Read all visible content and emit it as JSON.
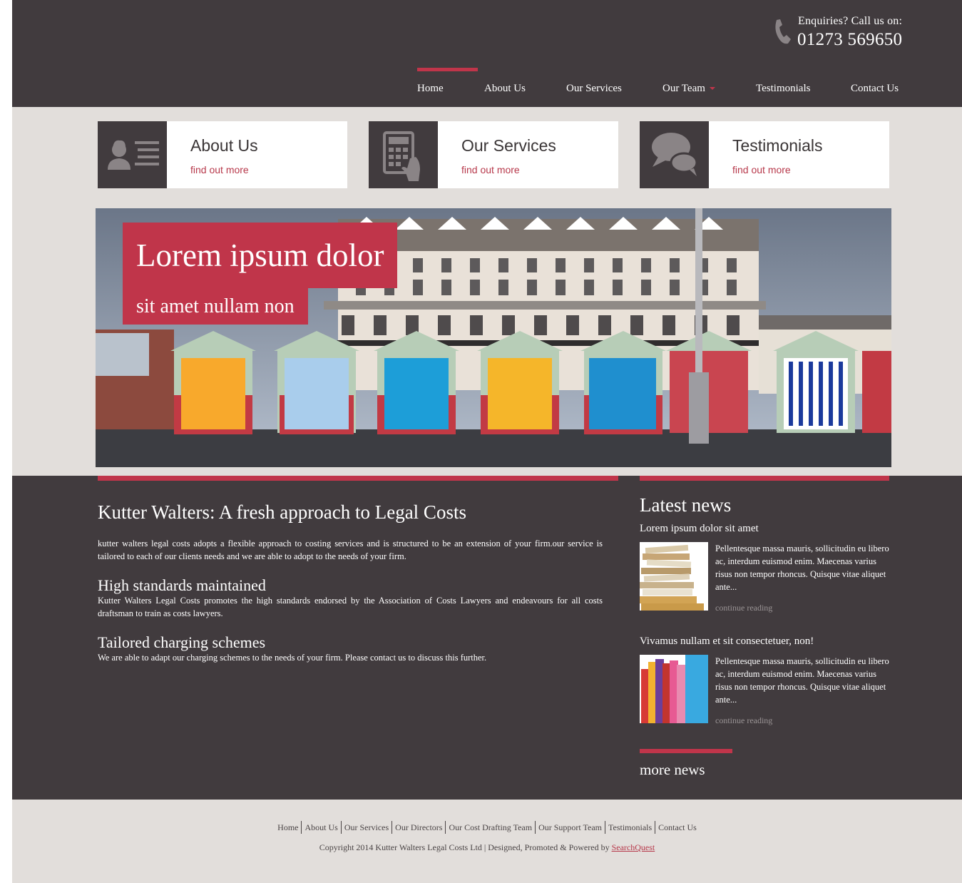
{
  "header": {
    "enquiries_label": "Enquiries? Call us on:",
    "phone_number": "01273 569650",
    "icon": "phone-icon"
  },
  "nav": {
    "items": [
      {
        "label": "Home",
        "active": true
      },
      {
        "label": "About Us"
      },
      {
        "label": "Our Services"
      },
      {
        "label": "Our Team",
        "has_dropdown": true
      },
      {
        "label": "Testimonials"
      },
      {
        "label": "Contact Us"
      }
    ]
  },
  "features": [
    {
      "title": "About Us",
      "link": "find out more",
      "icon": "person-list-icon"
    },
    {
      "title": "Our Services",
      "link": "find out more",
      "icon": "calculator-icon"
    },
    {
      "title": "Testimonials",
      "link": "find out more",
      "icon": "speech-bubbles-icon"
    }
  ],
  "banner": {
    "caption_line1": "Lorem ipsum dolor",
    "caption_line2": "sit amet nullam non"
  },
  "main": {
    "title": "Kutter Walters: A fresh approach to Legal Costs",
    "intro": "kutter walters legal costs adopts a flexible approach to costing services and is structured to be an extension of your firm.our service is tailored to each of our clients needs and we are able to adopt to the needs of your firm.",
    "sections": [
      {
        "heading": "High standards maintained",
        "text": "Kutter Walters Legal Costs promotes the high standards endorsed by the Association of Costs Lawyers and endeavours for all costs draftsman to train as costs lawyers."
      },
      {
        "heading": "Tailored charging schemes",
        "text": "We are able to adapt our charging schemes to the needs of your firm. Please contact us to discuss this further."
      }
    ]
  },
  "news": {
    "title": "Latest news",
    "items": [
      {
        "headline": "Lorem ipsum dolor sit amet",
        "text": "Pellentesque massa mauris, sollicitudin eu libero ac, interdum euismod enim. Maecenas varius risus non tempor rhoncus. Quisque vitae aliquet ante...",
        "more": "continue reading"
      },
      {
        "headline": "Vivamus nullam et sit consectetuer, non!",
        "text": "Pellentesque massa mauris, sollicitudin eu libero ac, interdum euismod enim. Maecenas varius risus non tempor rhoncus. Quisque vitae aliquet ante...",
        "more": "continue reading"
      }
    ],
    "more_news": "more news"
  },
  "footer": {
    "links": [
      "Home",
      "About Us",
      "Our Services",
      "Our Directors",
      "Our Cost Drafting Team",
      "Our Support Team",
      "Testimonials",
      "Contact Us"
    ],
    "copyright": "Copyright 2014 Kutter Walters Legal Costs Ltd | Designed, Promoted & Powered by",
    "powered_by": "SearchQuest"
  },
  "colors": {
    "dark": "#413b3e",
    "accent": "#c0354a",
    "light_bg": "#e2dedb"
  }
}
